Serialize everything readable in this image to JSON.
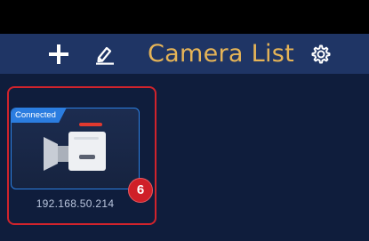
{
  "header": {
    "title": "Camera List",
    "icons": {
      "add": "plus-icon",
      "edit": "pencil-icon",
      "settings": "gear-icon"
    }
  },
  "cameras": [
    {
      "status": "Connected",
      "ip": "192.168.50.214",
      "icon": "video-camera-icon"
    }
  ],
  "annotation": {
    "number": "6"
  },
  "colors": {
    "header_bg": "#1f3565",
    "title": "#e6b457",
    "page_bg": "#0f1d3c",
    "highlight": "#d0232c",
    "connected_badge": "#2b7de0"
  }
}
